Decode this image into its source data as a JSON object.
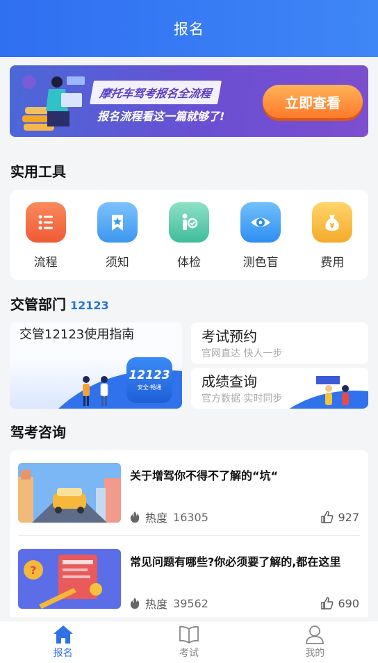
{
  "header": {
    "title": "报名"
  },
  "banner": {
    "line1": "摩托车驾考报名全流程",
    "line2": "报名流程看这一篇就够了!",
    "cta": "立即查看"
  },
  "tools": {
    "title": "实用工具",
    "items": [
      {
        "label": "流程",
        "icon": "list-icon",
        "color": "#f0663b"
      },
      {
        "label": "须知",
        "icon": "bookmark-star-icon",
        "color": "#4aa6f0"
      },
      {
        "label": "体检",
        "icon": "person-check-icon",
        "color": "#45c2a0"
      },
      {
        "label": "测色盲",
        "icon": "eye-icon",
        "color": "#3a9bf0"
      },
      {
        "label": "费用",
        "icon": "money-bag-icon",
        "color": "#f5b63a"
      }
    ]
  },
  "traffic": {
    "title": "交管部门",
    "subtitle": "12123",
    "guide": {
      "title": "交管12123使用指南",
      "app_name": "12123",
      "app_slogan": "安全·畅通"
    },
    "exam_booking": {
      "title": "考试预约",
      "sub": "官网直达 快人一步"
    },
    "score_query": {
      "title": "成绩查询",
      "sub": "官方数据 实时同步"
    }
  },
  "consult": {
    "title": "驾考咨询",
    "articles": [
      {
        "title": "关于增驾你不得不了解的“坑“",
        "heat_label": "热度",
        "heat": "16305",
        "likes": "927"
      },
      {
        "title": "常见问题有哪些?你必须要了解的,都在这里",
        "heat_label": "热度",
        "heat": "39562",
        "likes": "690"
      }
    ]
  },
  "tabbar": [
    {
      "label": "报名",
      "icon": "home-icon",
      "active": true
    },
    {
      "label": "考试",
      "icon": "book-icon",
      "active": false
    },
    {
      "label": "我的",
      "icon": "user-icon",
      "active": false
    }
  ]
}
